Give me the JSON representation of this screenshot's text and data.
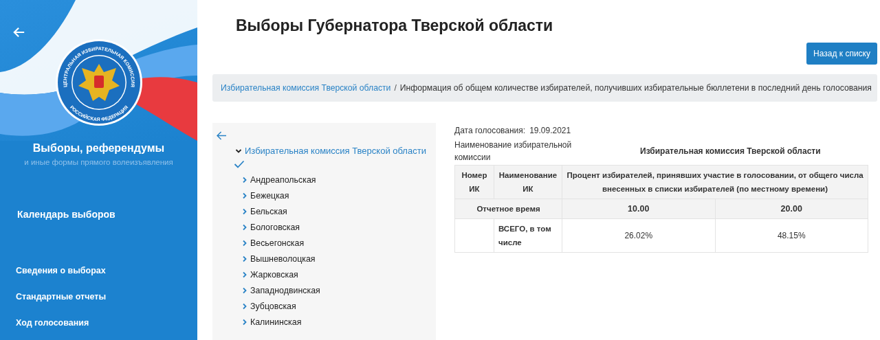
{
  "sidebar": {
    "emblem_text_top": "ЦЕНТРАЛЬНАЯ ИЗБИРАТЕЛЬНАЯ КОМИССИЯ",
    "emblem_text_bottom": "РОССИЙСКАЯ ФЕДЕРАЦИЯ",
    "title": "Выборы, референдумы",
    "subtitle": "и иные формы прямого волеизъявления",
    "calendar_link": "Календарь выборов",
    "nav_items": [
      "Сведения о выборах",
      "Стандартные отчеты",
      "Ход голосования"
    ]
  },
  "page": {
    "title": "Выборы Губернатора Тверской области",
    "back_button": "Назад к списку"
  },
  "breadcrumb": {
    "link": "Избирательная комиссия Тверской области",
    "separator": "/",
    "current": "Информация об общем количестве избирателей, получивших избирательные бюллетени в последний день голосования"
  },
  "tree": {
    "root": {
      "label": "Избирательная комиссия Тверской области",
      "expanded": true,
      "selected": true,
      "children": [
        {
          "label": "Андреапольская",
          "expanded": false
        },
        {
          "label": "Бежецкая",
          "expanded": false
        },
        {
          "label": "Бельская",
          "expanded": false
        },
        {
          "label": "Бологовская",
          "expanded": false
        },
        {
          "label": "Весьегонская",
          "expanded": false
        },
        {
          "label": "Вышневолоцкая",
          "expanded": false
        },
        {
          "label": "Жарковская",
          "expanded": false
        },
        {
          "label": "Западнодвинская",
          "expanded": false
        },
        {
          "label": "Зубцовская",
          "expanded": false
        },
        {
          "label": "Калининская",
          "expanded": false
        }
      ]
    }
  },
  "report": {
    "date_label": "Дата голосования:",
    "date_value": "19.09.2021",
    "commission_label": "Наименование избирательной комиссии",
    "commission_value": "Избирательная комиссия Тверской области",
    "table": {
      "columns": [
        "Номер ИК",
        "Наименование ИК",
        "Процент избирателей, принявших участие в голосовании, от общего числа внесенных в списки избирателей (по местному времени)"
      ],
      "time_label": "Отчетное время",
      "times": [
        "10.00",
        "20.00"
      ],
      "rows": [
        {
          "number": "",
          "name": "ВСЕГО, в том числе",
          "values": [
            "26.02%",
            "48.15%"
          ]
        }
      ]
    }
  }
}
